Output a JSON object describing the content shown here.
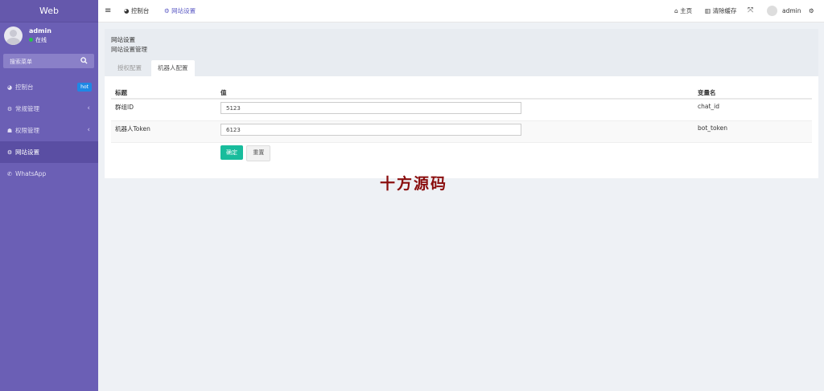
{
  "sidebar": {
    "brand": "Web",
    "user": {
      "name": "admin",
      "status": "在线"
    },
    "search_placeholder": "搜索菜单",
    "items": [
      {
        "label": "控制台",
        "icon": "dashboard-icon",
        "badge": "hot"
      },
      {
        "label": "常规管理",
        "icon": "cogs-icon",
        "caret": "‹"
      },
      {
        "label": "权限管理",
        "icon": "group-icon",
        "caret": "‹"
      },
      {
        "label": "网站设置",
        "icon": "cogs-icon"
      },
      {
        "label": "WhatsApp",
        "icon": "whatsapp-icon"
      }
    ]
  },
  "topbar": {
    "menu_icon": "≡",
    "tabs": [
      {
        "label": "控制台",
        "icon": "dashboard-icon"
      },
      {
        "label": "网站设置",
        "icon": "cogs-icon"
      }
    ],
    "home": "主页",
    "clear_cache": "清除缓存",
    "user": "admin"
  },
  "page": {
    "title": "网站设置",
    "subtitle": "网站设置管理",
    "tabs": [
      "授权配置",
      "机器人配置"
    ],
    "table": {
      "headers": [
        "标题",
        "值",
        "变量名"
      ],
      "rows": [
        {
          "label": "群组ID",
          "value": "5123",
          "var": "chat_id"
        },
        {
          "label": "机器人Token",
          "value": "6123",
          "var": "bot_token"
        }
      ]
    },
    "buttons": {
      "submit": "确定",
      "reset": "重置"
    }
  },
  "watermark": "十方源码",
  "colors": {
    "sidebar": "#6b5fb5",
    "accent": "#18bc9c",
    "badge": "#1e88e5",
    "active_tab": "#5d5bc5"
  }
}
